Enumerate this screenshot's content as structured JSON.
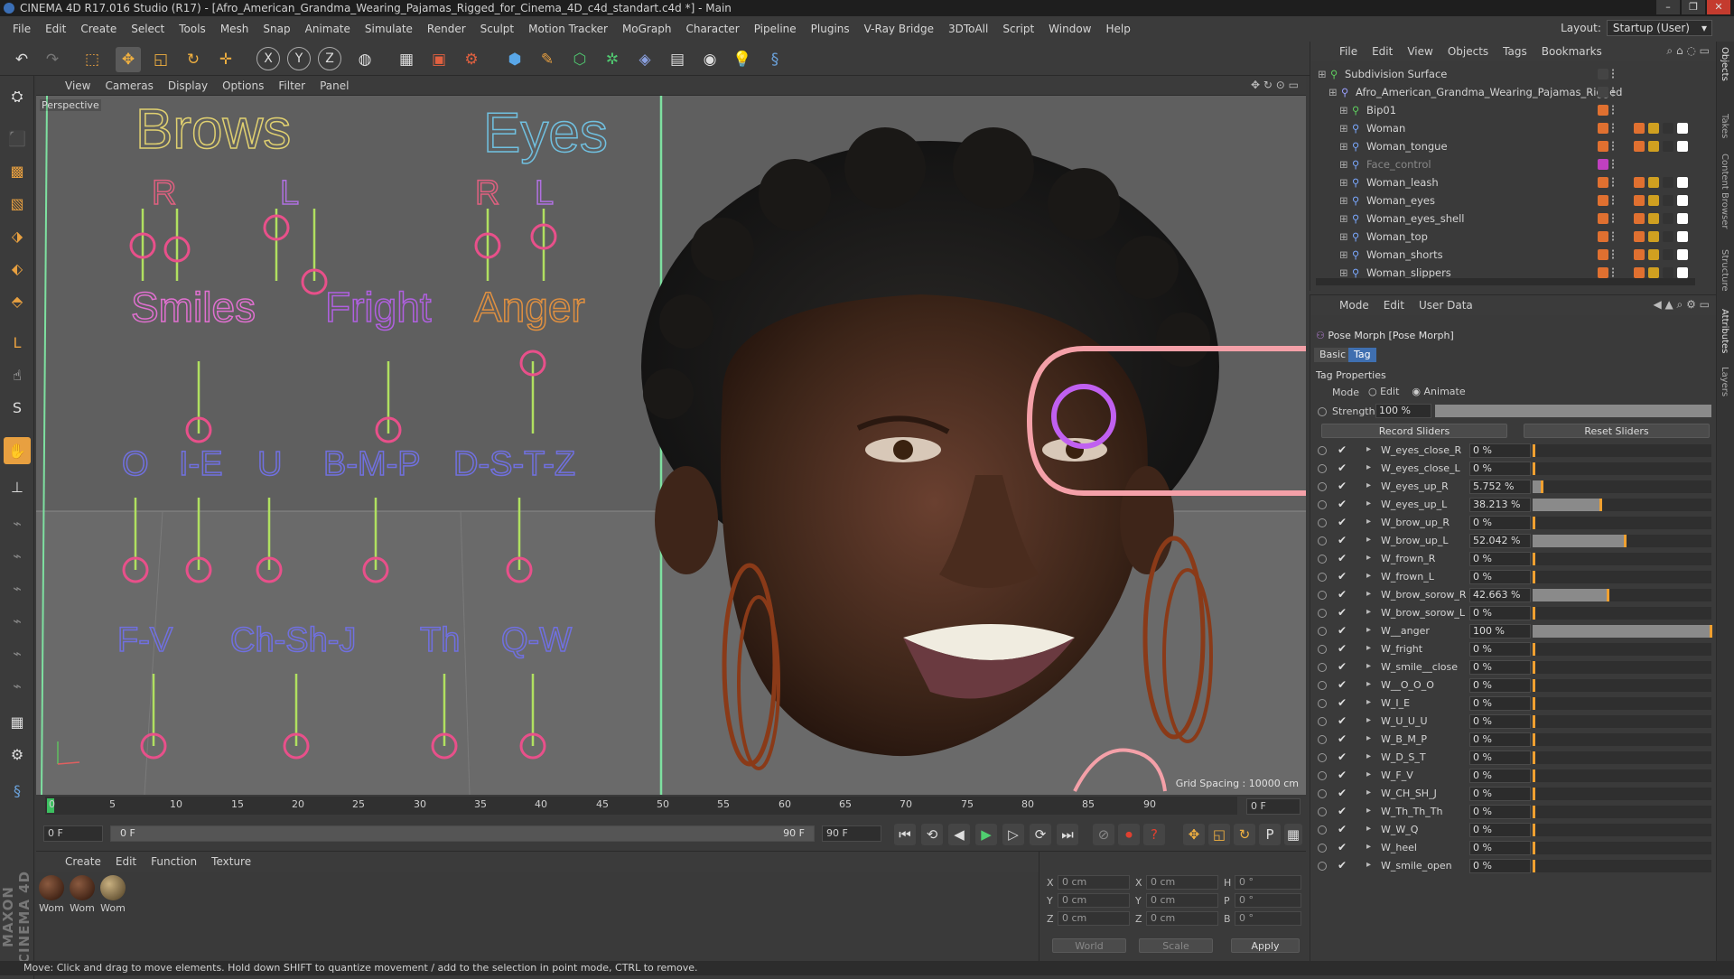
{
  "window": {
    "title": "CINEMA 4D R17.016 Studio (R17) - [Afro_American_Grandma_Wearing_Pajamas_Rigged_for_Cinema_4D_c4d_standart.c4d *] - Main",
    "controls": [
      "–",
      "❐",
      "✕"
    ]
  },
  "menubar": {
    "items": [
      "File",
      "Edit",
      "Create",
      "Select",
      "Tools",
      "Mesh",
      "Snap",
      "Animate",
      "Simulate",
      "Render",
      "Sculpt",
      "Motion Tracker",
      "MoGraph",
      "Character",
      "Pipeline",
      "Plugins",
      "V-Ray Bridge",
      "3DToAll",
      "Script",
      "Window",
      "Help"
    ],
    "layout_label": "Layout:",
    "layout_value": "Startup (User)"
  },
  "viewport": {
    "menu": [
      "View",
      "Cameras",
      "Display",
      "Options",
      "Filter",
      "Panel"
    ],
    "label": "Perspective",
    "grid_spacing": "Grid Spacing : 10000 cm"
  },
  "face_controls": {
    "brows": {
      "title": "Brows",
      "r": "R",
      "l": "L"
    },
    "eyes": {
      "title": "Eyes",
      "r": "R",
      "l": "L"
    },
    "smiles": "Smiles",
    "fright": "Fright",
    "anger": "Anger",
    "phonemes1": [
      "O",
      "I-E",
      "U",
      "B-M-P",
      "D-S-T-Z"
    ],
    "phonemes2": [
      "F-V",
      "Ch-Sh-J",
      "Th",
      "Q-W"
    ]
  },
  "timeline": {
    "ticks": [
      "0",
      "5",
      "10",
      "15",
      "20",
      "25",
      "30",
      "35",
      "40",
      "45",
      "50",
      "55",
      "60",
      "65",
      "70",
      "75",
      "80",
      "85",
      "90"
    ],
    "current_frame": "0 F"
  },
  "transport": {
    "start_field": "0 F",
    "range_start": "0 F",
    "range_end": "90 F",
    "end_field": "90 F"
  },
  "material_manager": {
    "menu": [
      "Create",
      "Edit",
      "Function",
      "Texture"
    ],
    "materials": [
      "Wom",
      "Wom",
      "Wom"
    ]
  },
  "coordinates": {
    "rows": [
      {
        "a": "X",
        "av": "0 cm",
        "b": "X",
        "bv": "0 cm",
        "c": "H",
        "cv": "0 °"
      },
      {
        "a": "Y",
        "av": "0 cm",
        "b": "Y",
        "bv": "0 cm",
        "c": "P",
        "cv": "0 °"
      },
      {
        "a": "Z",
        "av": "0 cm",
        "b": "Z",
        "bv": "0 cm",
        "c": "B",
        "cv": "0 °"
      }
    ],
    "world": "World",
    "scale": "Scale",
    "apply": "Apply"
  },
  "status": "Move: Click and drag to move elements. Hold down SHIFT to quantize movement / add to the selection in point mode, CTRL to remove.",
  "object_manager": {
    "menu": [
      "File",
      "Edit",
      "View",
      "Objects",
      "Tags",
      "Bookmarks"
    ],
    "objects": [
      {
        "name": "Subdivision Surface",
        "indent": 0,
        "color": "#5fcf5f"
      },
      {
        "name": "Afro_American_Grandma_Wearing_Pajamas_Rigged",
        "indent": 1,
        "color": "#9aa0ff"
      },
      {
        "name": "Bip01",
        "indent": 2,
        "color": "#5fcf5f"
      },
      {
        "name": "Woman",
        "indent": 2,
        "color": "#7aa8ff"
      },
      {
        "name": "Woman_tongue",
        "indent": 2,
        "color": "#7aa8ff"
      },
      {
        "name": "Face_control",
        "indent": 2,
        "color": "#7aa8ff",
        "dim": true
      },
      {
        "name": "Woman_leash",
        "indent": 2,
        "color": "#7aa8ff"
      },
      {
        "name": "Woman_eyes",
        "indent": 2,
        "color": "#7aa8ff"
      },
      {
        "name": "Woman_eyes_shell",
        "indent": 2,
        "color": "#7aa8ff"
      },
      {
        "name": "Woman_top",
        "indent": 2,
        "color": "#7aa8ff"
      },
      {
        "name": "Woman_shorts",
        "indent": 2,
        "color": "#7aa8ff"
      },
      {
        "name": "Woman_slippers",
        "indent": 2,
        "color": "#7aa8ff"
      }
    ]
  },
  "attributes": {
    "menu": [
      "Mode",
      "Edit",
      "User Data"
    ],
    "title": "Pose Morph [Pose Morph]",
    "tabs": [
      "Basic",
      "Tag"
    ],
    "section": "Tag Properties",
    "mode_label": "Mode",
    "mode_options": [
      "Edit",
      "Animate"
    ],
    "strength_label": "Strength",
    "strength_value": "100 %",
    "strength_fraction": 1.0,
    "record_button": "Record Sliders",
    "reset_button": "Reset Sliders",
    "sliders": [
      {
        "name": "W_eyes_close_R",
        "value": "0 %",
        "fraction": 0
      },
      {
        "name": "W_eyes_close_L",
        "value": "0 %",
        "fraction": 0
      },
      {
        "name": "W_eyes_up_R",
        "value": "5.752 %",
        "fraction": 0.05752
      },
      {
        "name": "W_eyes_up_L",
        "value": "38.213 %",
        "fraction": 0.38213
      },
      {
        "name": "W_brow_up_R",
        "value": "0 %",
        "fraction": 0
      },
      {
        "name": "W_brow_up_L",
        "value": "52.042 %",
        "fraction": 0.52042
      },
      {
        "name": "W_frown_R",
        "value": "0 %",
        "fraction": 0
      },
      {
        "name": "W_frown_L",
        "value": "0 %",
        "fraction": 0
      },
      {
        "name": "W_brow_sorow_R",
        "value": "42.663 %",
        "fraction": 0.42663
      },
      {
        "name": "W_brow_sorow_L",
        "value": "0 %",
        "fraction": 0
      },
      {
        "name": "W__anger",
        "value": "100 %",
        "fraction": 1.0
      },
      {
        "name": "W_fright",
        "value": "0 %",
        "fraction": 0
      },
      {
        "name": "W_smile__close",
        "value": "0 %",
        "fraction": 0
      },
      {
        "name": "W__O_O_O",
        "value": "0 %",
        "fraction": 0
      },
      {
        "name": "W_I_E",
        "value": "0 %",
        "fraction": 0
      },
      {
        "name": "W_U_U_U",
        "value": "0 %",
        "fraction": 0
      },
      {
        "name": "W_B_M_P",
        "value": "0 %",
        "fraction": 0
      },
      {
        "name": "W_D_S_T",
        "value": "0 %",
        "fraction": 0
      },
      {
        "name": "W_F_V",
        "value": "0 %",
        "fraction": 0
      },
      {
        "name": "W_CH_SH_J",
        "value": "0 %",
        "fraction": 0
      },
      {
        "name": "W_Th_Th_Th",
        "value": "0 %",
        "fraction": 0
      },
      {
        "name": "W_W_Q",
        "value": "0 %",
        "fraction": 0
      },
      {
        "name": "W_heel",
        "value": "0 %",
        "fraction": 0
      },
      {
        "name": "W_smile_open",
        "value": "0 %",
        "fraction": 0
      }
    ]
  },
  "side_tabs": [
    "Objects",
    "Takes",
    "Content Browser",
    "Structure",
    "Attributes",
    "Layers"
  ]
}
